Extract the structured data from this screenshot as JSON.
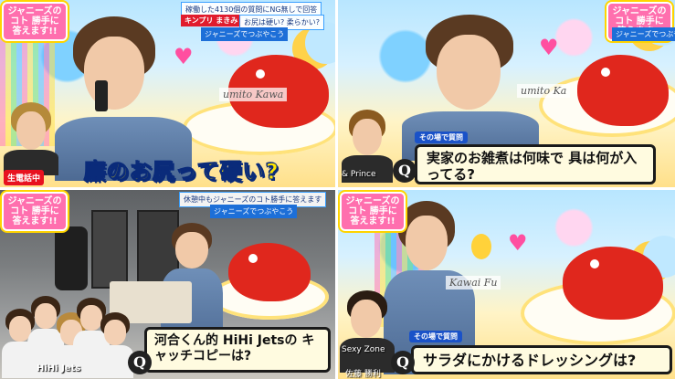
{
  "panels": [
    {
      "logo": "ジャニーズのコト 勝手に答えます!!",
      "topbar": "稼働した4130個の質問にNG無しで回答",
      "tagbar": "キンプリ まきみ",
      "topbar2": "お尻は硬い? 柔らかい?",
      "subbar": "ジャニーズでつぶやこう",
      "namecard": "umito Kawa",
      "live_badge": "生電話中",
      "caption": "廉のお尻って硬い?"
    },
    {
      "logo": "ジャニーズのコト 勝手に答えます!!",
      "subbar": "ジャニーズでつぶやこう",
      "namecard": "umito Ka",
      "corner_name": "& Prince",
      "qtag": "その場で質問",
      "question": "実家のお雑煮は何味で 具は何が入ってる?",
      "qicon": "Q"
    },
    {
      "logo": "ジャニーズのコト 勝手に答えます!!",
      "topbar": "休憩中もジャニーズのコト勝手に答えます",
      "subbar": "ジャニーズでつぶやこう",
      "group_label": "HiHi Jets",
      "question": "河合くん的 HiHi Jetsの キャッチコピーは?",
      "qicon": "Q"
    },
    {
      "logo": "ジャニーズのコト 勝手に答えます!!",
      "namecard": "Kawai Fu",
      "corner_name": "Sexy Zone",
      "corner_name2": "佐藤 勝利",
      "qtag": "その場で質問",
      "question": "サラダにかけるドレッシングは?",
      "qicon": "Q"
    }
  ]
}
